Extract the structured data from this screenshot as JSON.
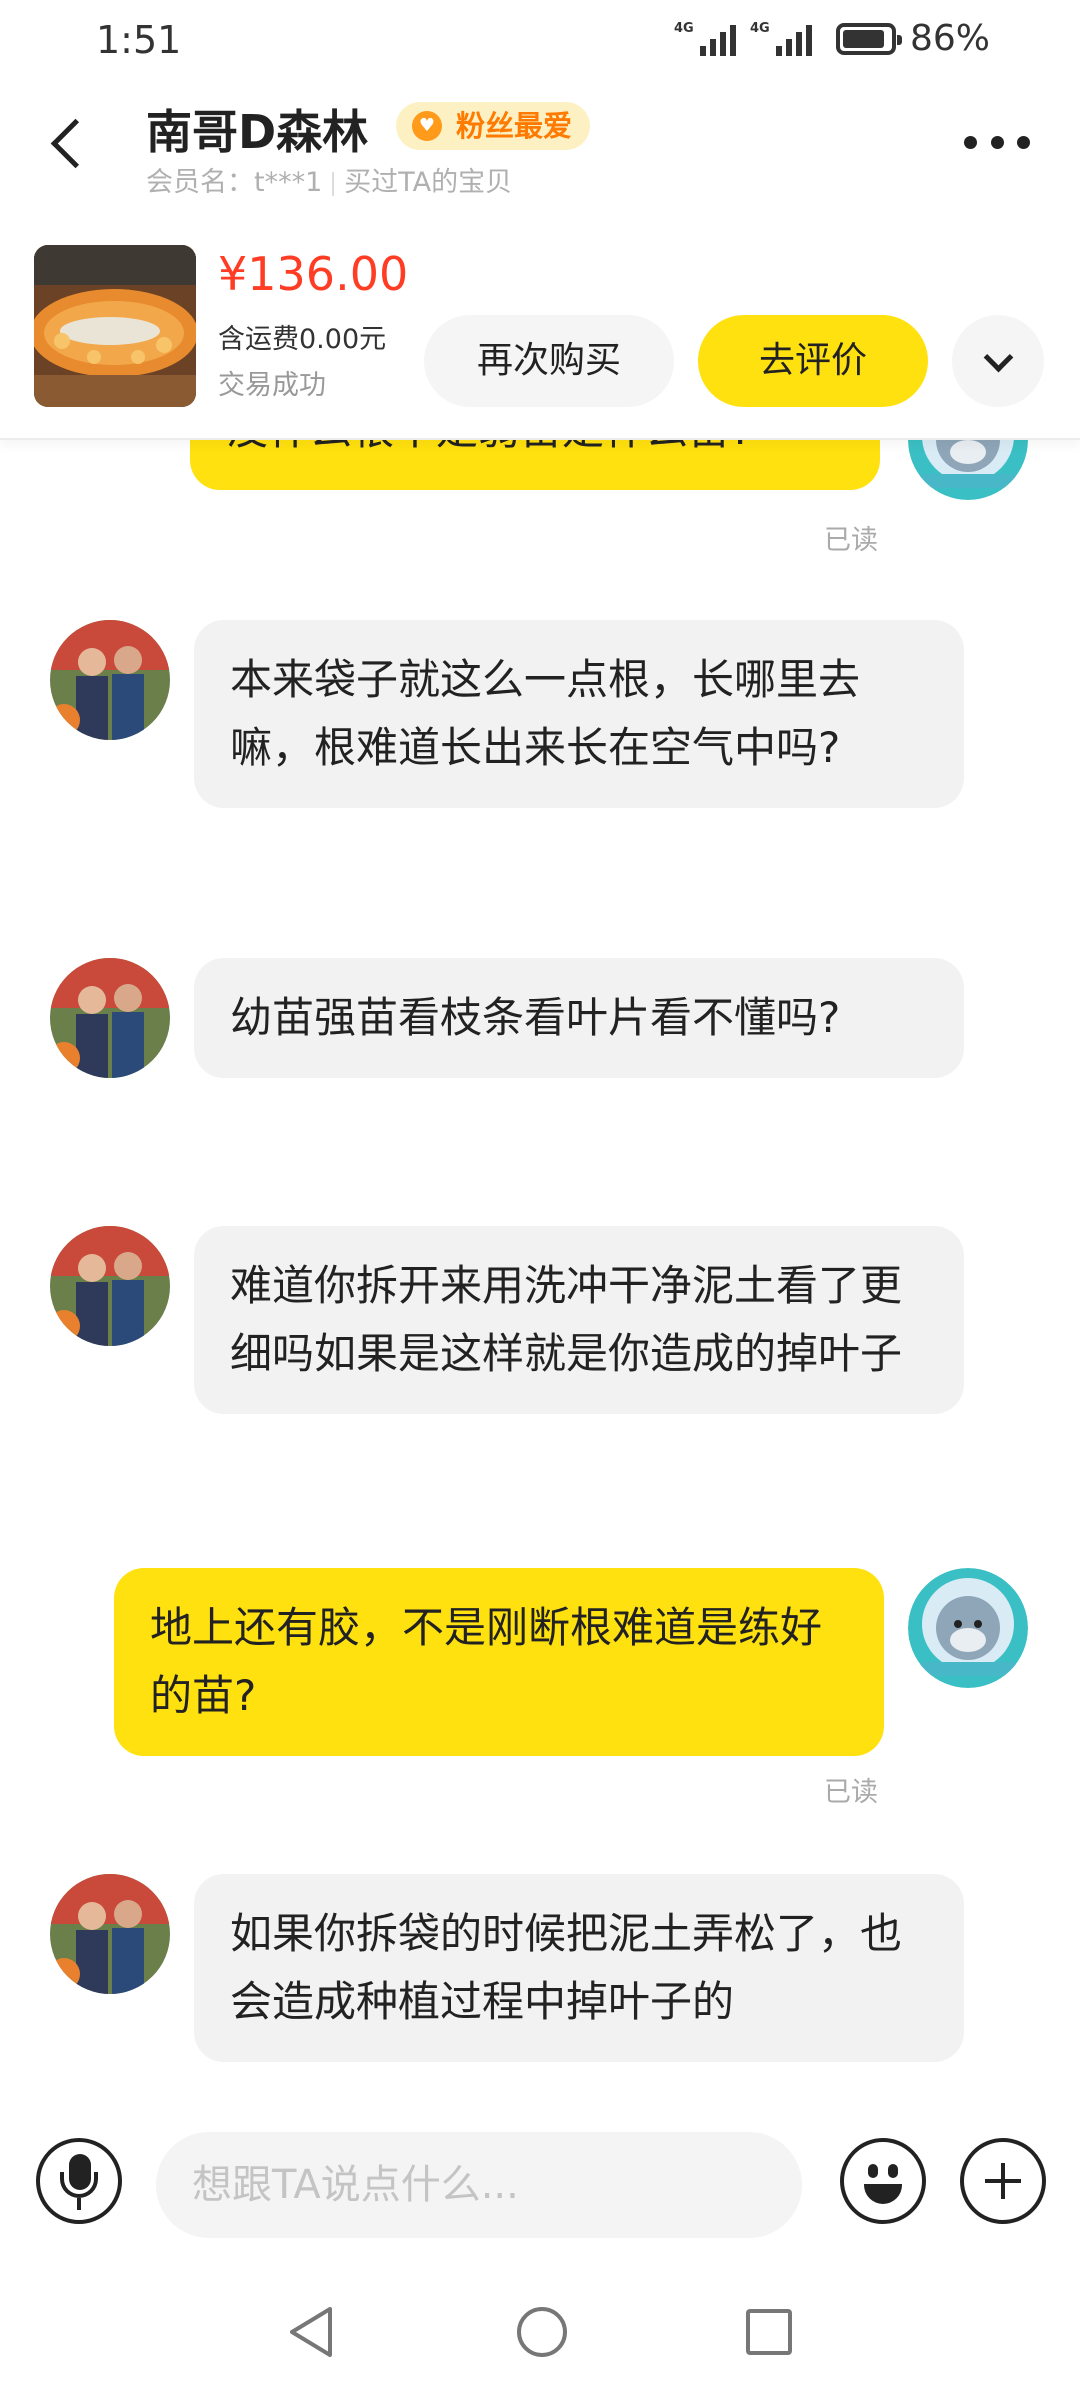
{
  "status_bar": {
    "time": "1:51",
    "network_1": "4G",
    "network_2": "4G",
    "battery": "86%",
    "battery_level": 0.86
  },
  "header": {
    "name": "南哥D森林",
    "badge": "粉丝最爱",
    "member_label": "会员名：t***1",
    "bought_label": "买过TA的宝贝"
  },
  "order": {
    "price": "¥136.00",
    "shipping": "含运费0.00元",
    "status": "交易成功",
    "rebuy_label": "再次购买",
    "review_label": "去评价"
  },
  "messages": [
    {
      "side": "out",
      "text": "没什么根不是弱苗是什么苗?",
      "read": "已读"
    },
    {
      "side": "in",
      "text": "本来袋子就这么一点根，长哪里去嘛，根难道长出来长在空气中吗?"
    },
    {
      "side": "in",
      "text": "幼苗强苗看枝条看叶片看不懂吗?"
    },
    {
      "side": "in",
      "text": "难道你拆开来用洗冲干净泥土看了更细吗如果是这样就是你造成的掉叶子"
    },
    {
      "side": "out",
      "text": "地上还有胶，不是刚断根难道是练好的苗?",
      "read": "已读"
    },
    {
      "side": "in",
      "text": "如果你拆袋的时候把泥土弄松了，也会造成种植过程中掉叶子的"
    }
  ],
  "input": {
    "placeholder": "想跟TA说点什么..."
  },
  "colors": {
    "accent_yellow": "#ffe10f",
    "price_red": "#ff3c24",
    "badge_orange": "#ff7a00"
  }
}
